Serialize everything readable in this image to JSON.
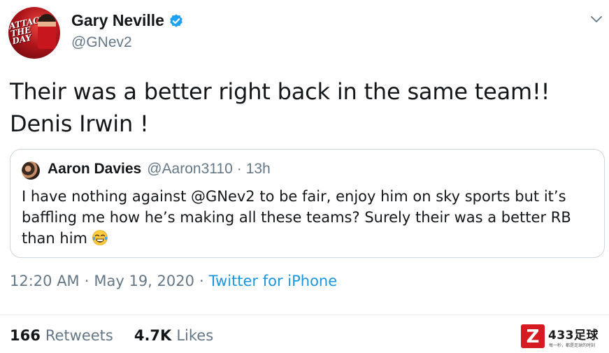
{
  "tweet": {
    "avatar_text": "ATTACK THE DAY",
    "display_name": "Gary Neville",
    "handle": "@GNev2",
    "verified_icon": "verified-badge-icon",
    "menu_icon": "chevron-down-icon",
    "text_line1": "Their was a better right back in the same team!!",
    "text_line2": "Denis Irwin !"
  },
  "quote": {
    "display_name": "Aaron Davies",
    "handle": "@Aaron3110",
    "separator": "·",
    "time": "13h",
    "text": "I have nothing against @GNev2 to be fair, enjoy him on sky sports but it’s baffling me how he’s making all these teams? Surely their was a better RB than him",
    "emoji_icon": "face-with-tears-of-joy-icon"
  },
  "meta": {
    "time": "12:20 AM",
    "separator": "·",
    "date": "May 19, 2020",
    "source": "Twitter for iPhone"
  },
  "stats": {
    "retweets_count": "166",
    "retweets_label": "Retweets",
    "likes_count": "4.7K",
    "likes_label": "Likes"
  },
  "watermark": {
    "logo_letter": "Z",
    "text": "433足球",
    "subtext": "每一秒，都是足球的时刻"
  },
  "colors": {
    "text_primary": "#14171a",
    "text_secondary": "#657786",
    "link": "#1b95e0",
    "verified": "#1da1f2",
    "border": "#ccd6dd",
    "watermark_red": "#d71a21"
  }
}
